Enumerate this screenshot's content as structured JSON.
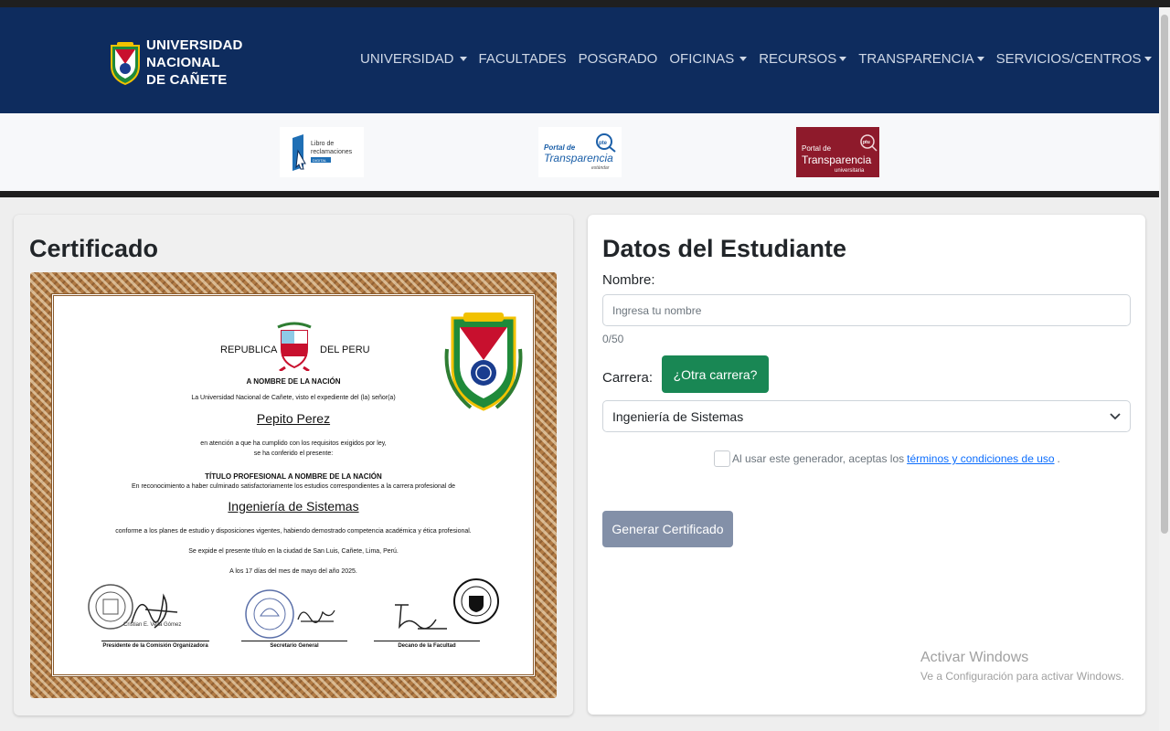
{
  "header": {
    "logo_lines": [
      "UNIVERSIDAD",
      "NACIONAL",
      "DE CAÑETE"
    ],
    "nav": [
      {
        "label": "UNIVERSIDAD",
        "dropdown": true
      },
      {
        "label": "FACULTADES",
        "dropdown": false
      },
      {
        "label": "POSGRADO",
        "dropdown": false
      },
      {
        "label": "OFICINAS",
        "dropdown": true
      },
      {
        "label": "RECURSOS",
        "dropdown": true
      },
      {
        "label": "TRANSPARENCIA",
        "dropdown": true
      },
      {
        "label": "SERVICIOS/CENTROS",
        "dropdown": true
      }
    ]
  },
  "partners": {
    "libro": {
      "line1": "Libro de",
      "line2": "reclamaciones",
      "tag": "DIGITAL"
    },
    "pte": {
      "line1": "Portal de",
      "line2": "Transparencia",
      "line3": "estándar",
      "badge": "pte"
    },
    "ptu": {
      "line1": "Portal de",
      "line2": "Transparencia",
      "line3": "universitaria",
      "badge": "ptu"
    }
  },
  "certificate": {
    "heading": "Certificado",
    "republic_left": "REPUBLICA",
    "republic_right": "DEL PERU",
    "nation": "A NOMBRE DE LA NACIÓN",
    "intro": "La Universidad Nacional de Cañete, visto el expediente del (la) señor(a)",
    "student_name": "Pepito Perez",
    "attention_1": "en atención a que ha cumplido con los requisitos exigidos por ley,",
    "attention_2": "se ha conferido el presente:",
    "title_line": "TÍTULO PROFESIONAL A NOMBRE DE LA NACIÓN",
    "recognition": "En reconocimiento a haber culminado satisfactoriamente los estudios correspondientes a la carrera profesional de",
    "career": "Ingeniería de Sistemas",
    "conformity": "conforme a los planes de estudio y disposiciones vigentes, habiendo demostrado competencia académica y ética profesional.",
    "issued": "Se expide el presente título en la ciudad de San Luis, Cañete, Lima, Perú.",
    "date": "A los 17 días del mes de mayo del año 2025.",
    "sig_name": "Cristian E. Vella Gómez",
    "signatures": [
      "Presidente de la Comisión Organizadora",
      "Secretario General",
      "Decano de la Facultad"
    ]
  },
  "form": {
    "heading": "Datos del Estudiante",
    "name_label": "Nombre:",
    "name_value": "",
    "name_placeholder": "Ingresa tu nombre",
    "counter": "0/50",
    "career_label": "Carrera:",
    "other_career_button": "¿Otra carrera?",
    "career_selected": "Ingeniería de Sistemas",
    "terms_prefix": "Al usar este generador, aceptas los",
    "terms_link": "términos y condiciones de uso",
    "terms_suffix": ".",
    "generate_button": "Generar Certificado"
  },
  "watermark": {
    "line1": "Activar Windows",
    "line2": "Ve a Configuración para activar Windows."
  },
  "colors": {
    "navbar": "#0e2c5e",
    "success": "#198754",
    "disabled_button": "#8390a8",
    "link": "#0d6efd"
  }
}
